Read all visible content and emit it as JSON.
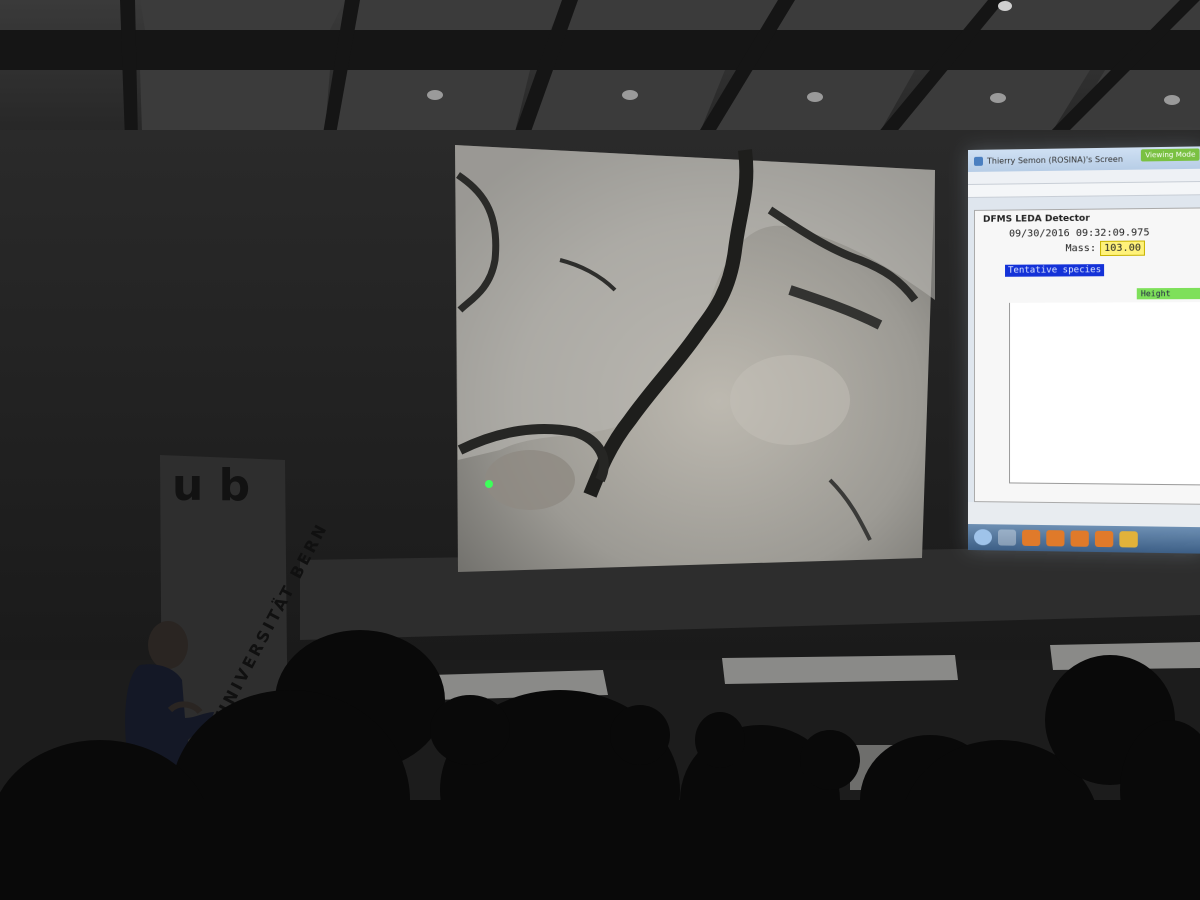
{
  "banner": {
    "logo_letters": "u b",
    "text": "UNIVERSITÄT BERN"
  },
  "right_screen": {
    "window_title": "Thierry Semon (ROSINA)'s Screen",
    "header_button": "Viewing Mode",
    "panel_title": "DFMS LEDA Detector",
    "timestamp": "09/30/2016 09:32:09.975",
    "mass_label": "Mass:",
    "mass_value": "103.00",
    "tentative_label": "Tentative species",
    "height_label": "Height"
  },
  "colors": {
    "room": "#1c1c1c",
    "mass_highlight": "#fff27a",
    "tentative_bg": "#1432d8",
    "height_bg": "#7ee05a"
  }
}
